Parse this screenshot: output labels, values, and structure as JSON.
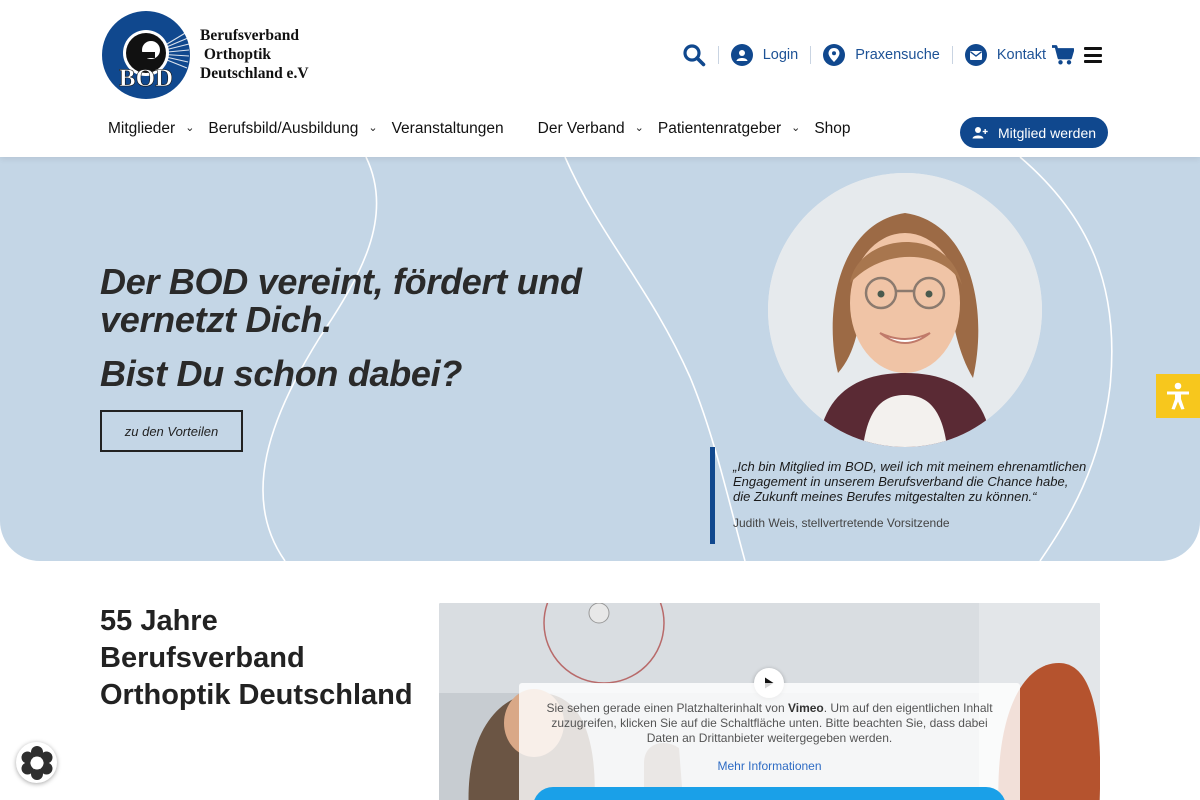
{
  "brand": {
    "logo_text": "BOD",
    "name_lines": "Berufsverband\n Orthoptik\nDeutschland e.V"
  },
  "utility": {
    "login": "Login",
    "praxensuche": "Praxensuche",
    "kontakt": "Kontakt"
  },
  "nav": {
    "items": [
      {
        "label": "Mitglieder",
        "dropdown": true
      },
      {
        "label": "Berufsbild/Ausbildung",
        "dropdown": true
      },
      {
        "label": "Veranstaltungen",
        "dropdown": false
      },
      {
        "label": "Der Verband",
        "dropdown": true
      },
      {
        "label": "Patientenratgeber",
        "dropdown": true
      },
      {
        "label": "Shop",
        "dropdown": false
      }
    ],
    "cta": "Mitglied werden"
  },
  "hero": {
    "headline": "Der BOD vereint, fördert und vernetzt Dich.",
    "subheadline": "Bist Du schon dabei?",
    "button": "zu den Vorteilen",
    "quote": "„Ich bin Mitglied im BOD, weil ich mit meinem ehrenamtlichen Engagement in unserem Berufsverband die Chance habe, die Zukunft meines Berufes mitgestalten zu können.“",
    "quote_author": "Judith Weis, stellvertretende Vorsitzende"
  },
  "section": {
    "title": "55 Jahre Berufsverband Orthoptik Deutschland"
  },
  "video_placeholder": {
    "text_before": "Sie sehen gerade einen Platzhalterinhalt von ",
    "provider": "Vimeo",
    "text_after": ". Um auf den eigentlichen Inhalt zuzugreifen, klicken Sie auf die Schaltfläche unten. Bitte beachten Sie, dass dabei Daten an Drittanbieter weitergegeben werden.",
    "more_info": "Mehr Informationen"
  },
  "colors": {
    "brand_blue": "#10488e",
    "hero_bg": "#c4d6e6",
    "accessibility_yellow": "#f7c71d",
    "vimeo_button": "#1aa0e8"
  }
}
